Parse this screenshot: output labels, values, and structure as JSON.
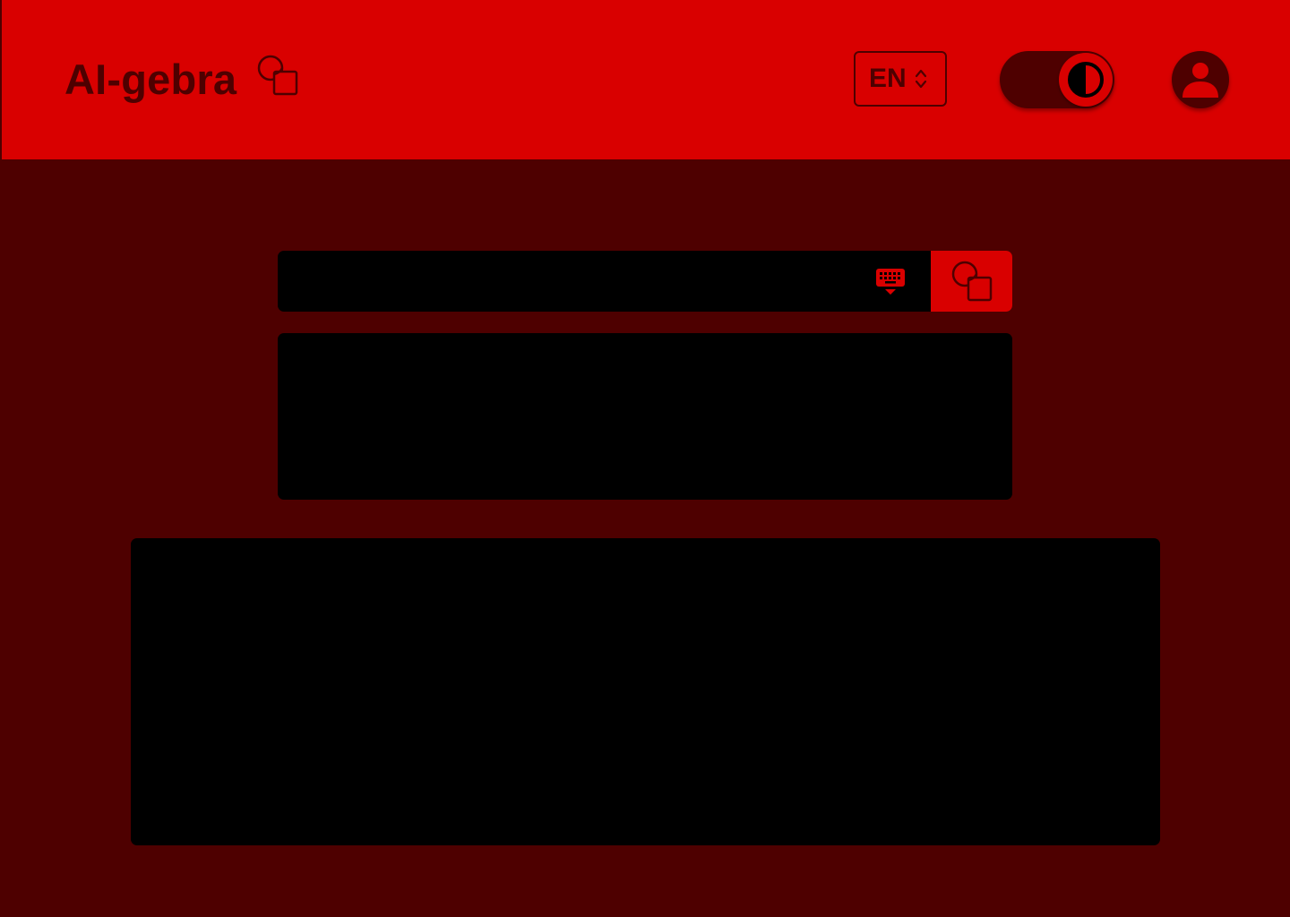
{
  "app": {
    "title": "AI-gebra",
    "logo_icon": "circle-square-icon"
  },
  "header": {
    "language": {
      "selected": "EN",
      "icon": "chevron-up-down-icon"
    },
    "theme_toggle": {
      "icon": "contrast-icon",
      "state": "on"
    },
    "account": {
      "icon": "user-icon"
    }
  },
  "search": {
    "value": "",
    "placeholder": "",
    "keyboard_icon": "keyboard-icon",
    "submit_icon": "circle-square-icon"
  },
  "colors": {
    "accent": "#d90000",
    "background": "#4e0000",
    "panel": "#000000"
  }
}
